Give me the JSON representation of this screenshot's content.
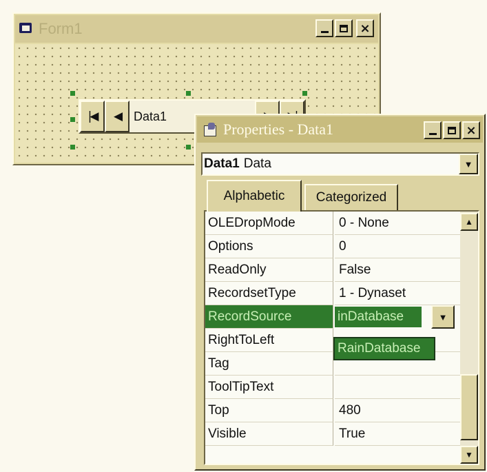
{
  "form_window": {
    "title": "Form1",
    "buttons": {
      "minimize": "minimize",
      "maximize": "maximize",
      "close": "×"
    },
    "data_control": {
      "caption": "Data1",
      "nav": {
        "first": "|◀",
        "prev": "◀",
        "next": "▶",
        "last": "▶|"
      }
    }
  },
  "properties_window": {
    "title": "Properties - Data1",
    "close_glyph": "×",
    "object_selector": {
      "name": "Data1",
      "type": "Data",
      "arrow": "▼"
    },
    "tabs": [
      {
        "label": "Alphabetic",
        "active": true
      },
      {
        "label": "Categorized",
        "active": false
      }
    ],
    "rows": [
      {
        "name": "OLEDropMode",
        "value": "0 - None"
      },
      {
        "name": "Options",
        "value": "0"
      },
      {
        "name": "ReadOnly",
        "value": "False"
      },
      {
        "name": "RecordsetType",
        "value": "1 - Dynaset"
      },
      {
        "name": "RecordSource",
        "value": "inDatabase",
        "selected": true
      },
      {
        "name": "RightToLeft",
        "value": ""
      },
      {
        "name": "Tag",
        "value": ""
      },
      {
        "name": "ToolTipText",
        "value": ""
      },
      {
        "name": "Top",
        "value": "480"
      },
      {
        "name": "Visible",
        "value": "True"
      }
    ],
    "dropdown_option": "RainDatabase",
    "scroll": {
      "up": "▲",
      "down": "▼"
    }
  },
  "colors": {
    "selection_green": "#2f7a2c",
    "selection_text": "#c7efb5",
    "window_face": "#dcd3a2"
  }
}
